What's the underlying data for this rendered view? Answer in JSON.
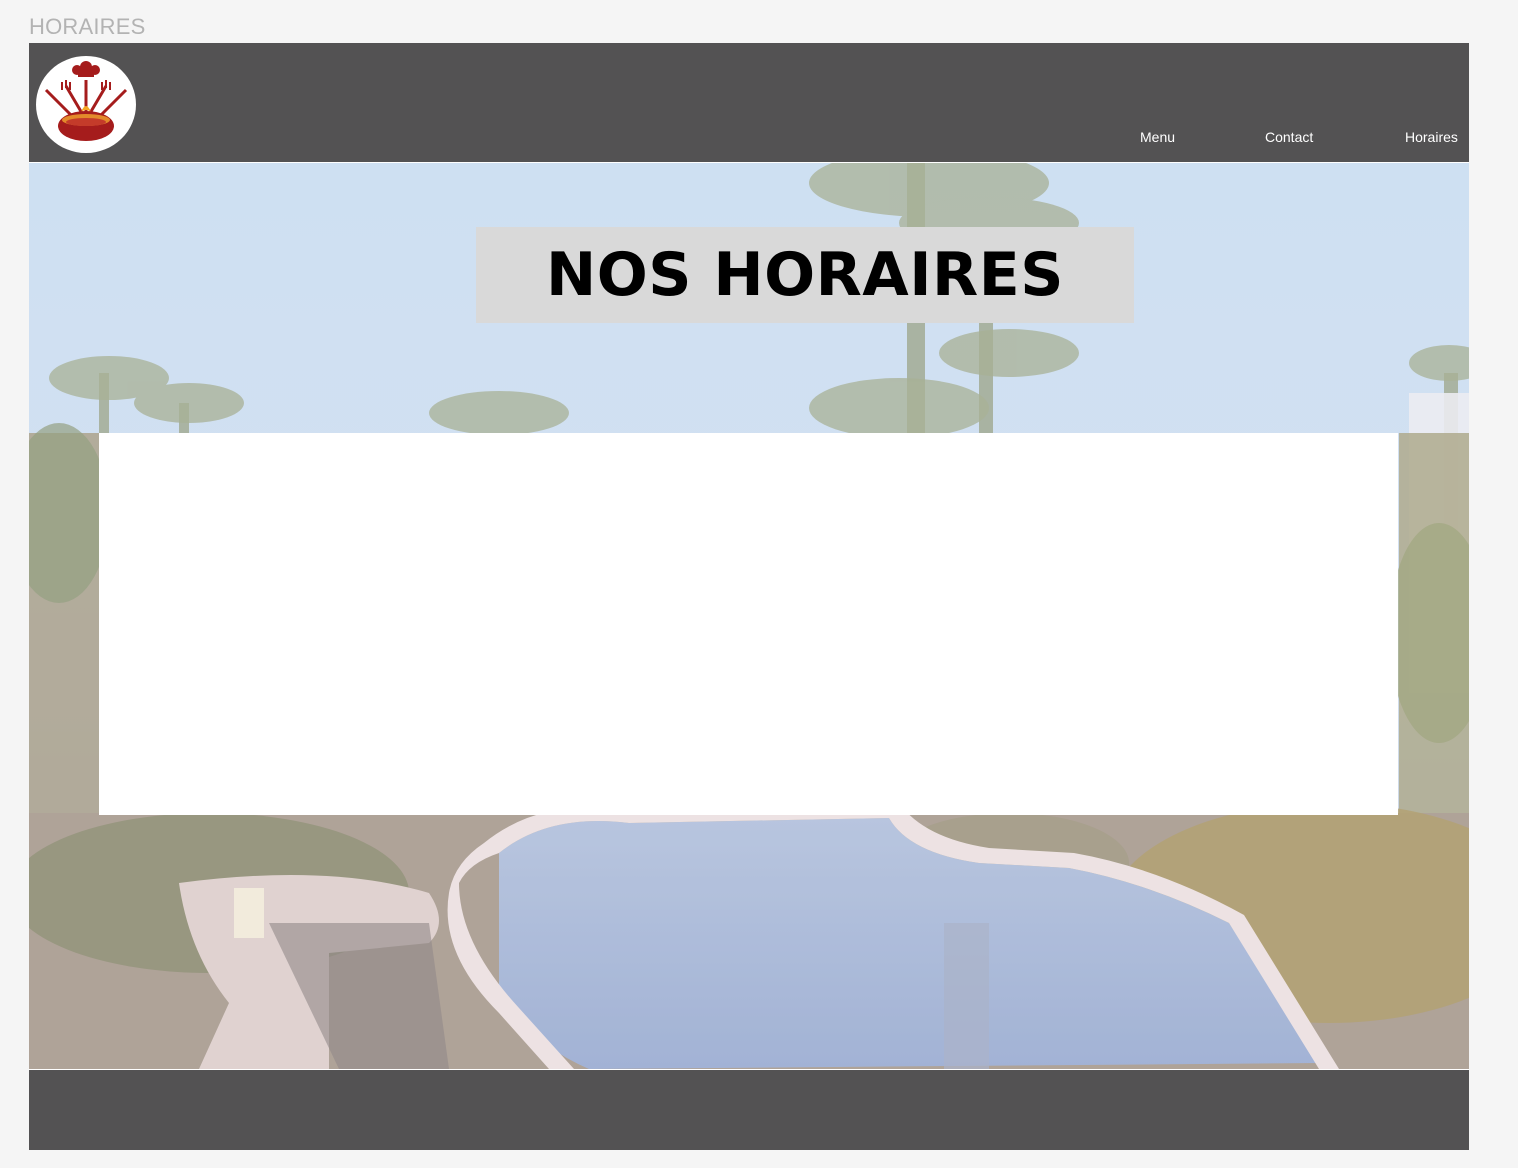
{
  "frame": {
    "label": "HORAIRES"
  },
  "header": {
    "logo_icon": "chef-restaurant-logo-icon",
    "nav": [
      {
        "label": "Menu"
      },
      {
        "label": "Contact"
      },
      {
        "label": "Horaires"
      }
    ]
  },
  "hero": {
    "background_image": "resort-pool-palm-trees-at-dusk",
    "title": "NOS HORAIRES"
  },
  "colors": {
    "header_bg": "#535253",
    "footer_bg": "#535253",
    "title_box_bg": "#d9d9d9",
    "logo_red": "#a51c1c",
    "page_bg": "#f5f5f5",
    "frame_label": "#b3b3b3"
  }
}
